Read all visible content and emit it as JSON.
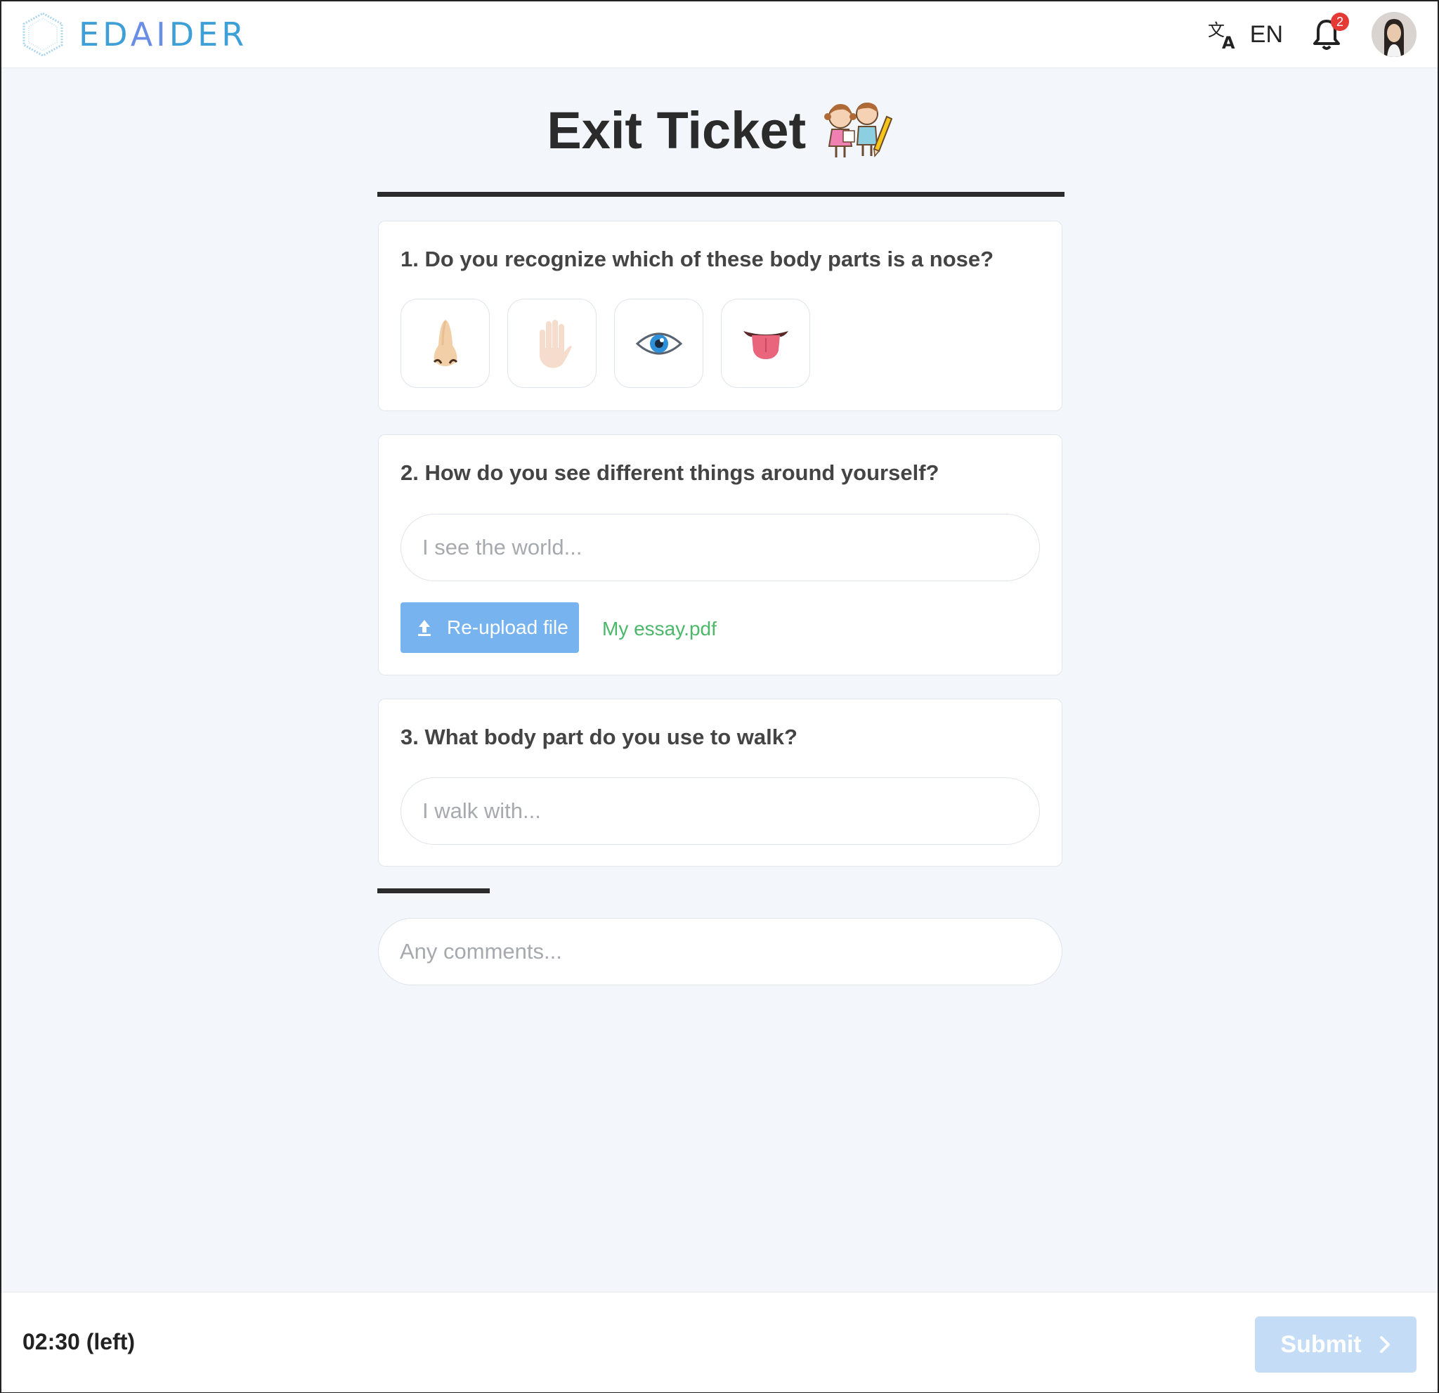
{
  "header": {
    "brand_prefix": "ED",
    "brand_ai": "AI",
    "brand_suffix": "DER",
    "language_icon": "translate-icon",
    "language": "EN",
    "notification_count": "2"
  },
  "page": {
    "title": "Exit Ticket"
  },
  "questions": [
    {
      "text": "1. Do you recognize which of these body parts is a nose?",
      "choices": [
        "nose",
        "hand",
        "eye",
        "tongue"
      ]
    },
    {
      "text": "2. How do you see different things around yourself?",
      "placeholder": "I see the world...",
      "upload_label": "Re-upload file",
      "file_name": "My essay.pdf"
    },
    {
      "text": "3. What body part do you use to walk?",
      "placeholder": "I walk with..."
    }
  ],
  "comments": {
    "placeholder": "Any comments..."
  },
  "footer": {
    "timer": "02:30 (left)",
    "submit_label": "Submit"
  },
  "colors": {
    "brand": "#3fa0d8",
    "upload_button": "#76b3ef",
    "file_link": "#4cb86a",
    "submit_disabled": "#c4dcf6",
    "badge": "#e53935"
  }
}
